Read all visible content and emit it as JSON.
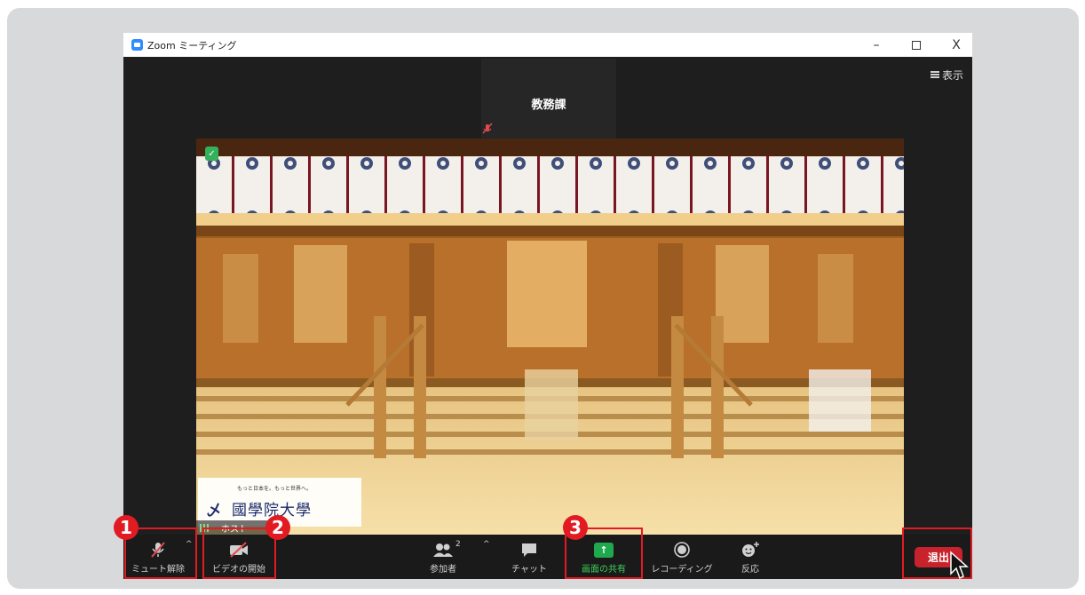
{
  "window": {
    "title": "Zoom ミーティング",
    "minimize": "–",
    "close": "X",
    "view_label": "表示"
  },
  "participant_tile": {
    "name": "教務課"
  },
  "video": {
    "logo_small_text": "もっと日本を。もっと世界へ。",
    "logo_mark": "乄",
    "logo_main_text": "國學院大學",
    "host_label": "ホスト"
  },
  "toolbar": {
    "unmute_label": "ミュート解除",
    "start_video_label": "ビデオの開始",
    "participants_label": "参加者",
    "participants_count": "2",
    "chat_label": "チャット",
    "share_label": "画面の共有",
    "record_label": "レコーディング",
    "reactions_label": "反応",
    "leave_label": "退出",
    "caret": "^"
  },
  "annotations": {
    "badge_1": "1",
    "badge_2": "2",
    "badge_3": "3"
  },
  "colors": {
    "highlight": "#e21b22",
    "share_green": "#1fa84d",
    "leave_red": "#c8232c",
    "toolbar_bg": "#1a1a1a"
  }
}
